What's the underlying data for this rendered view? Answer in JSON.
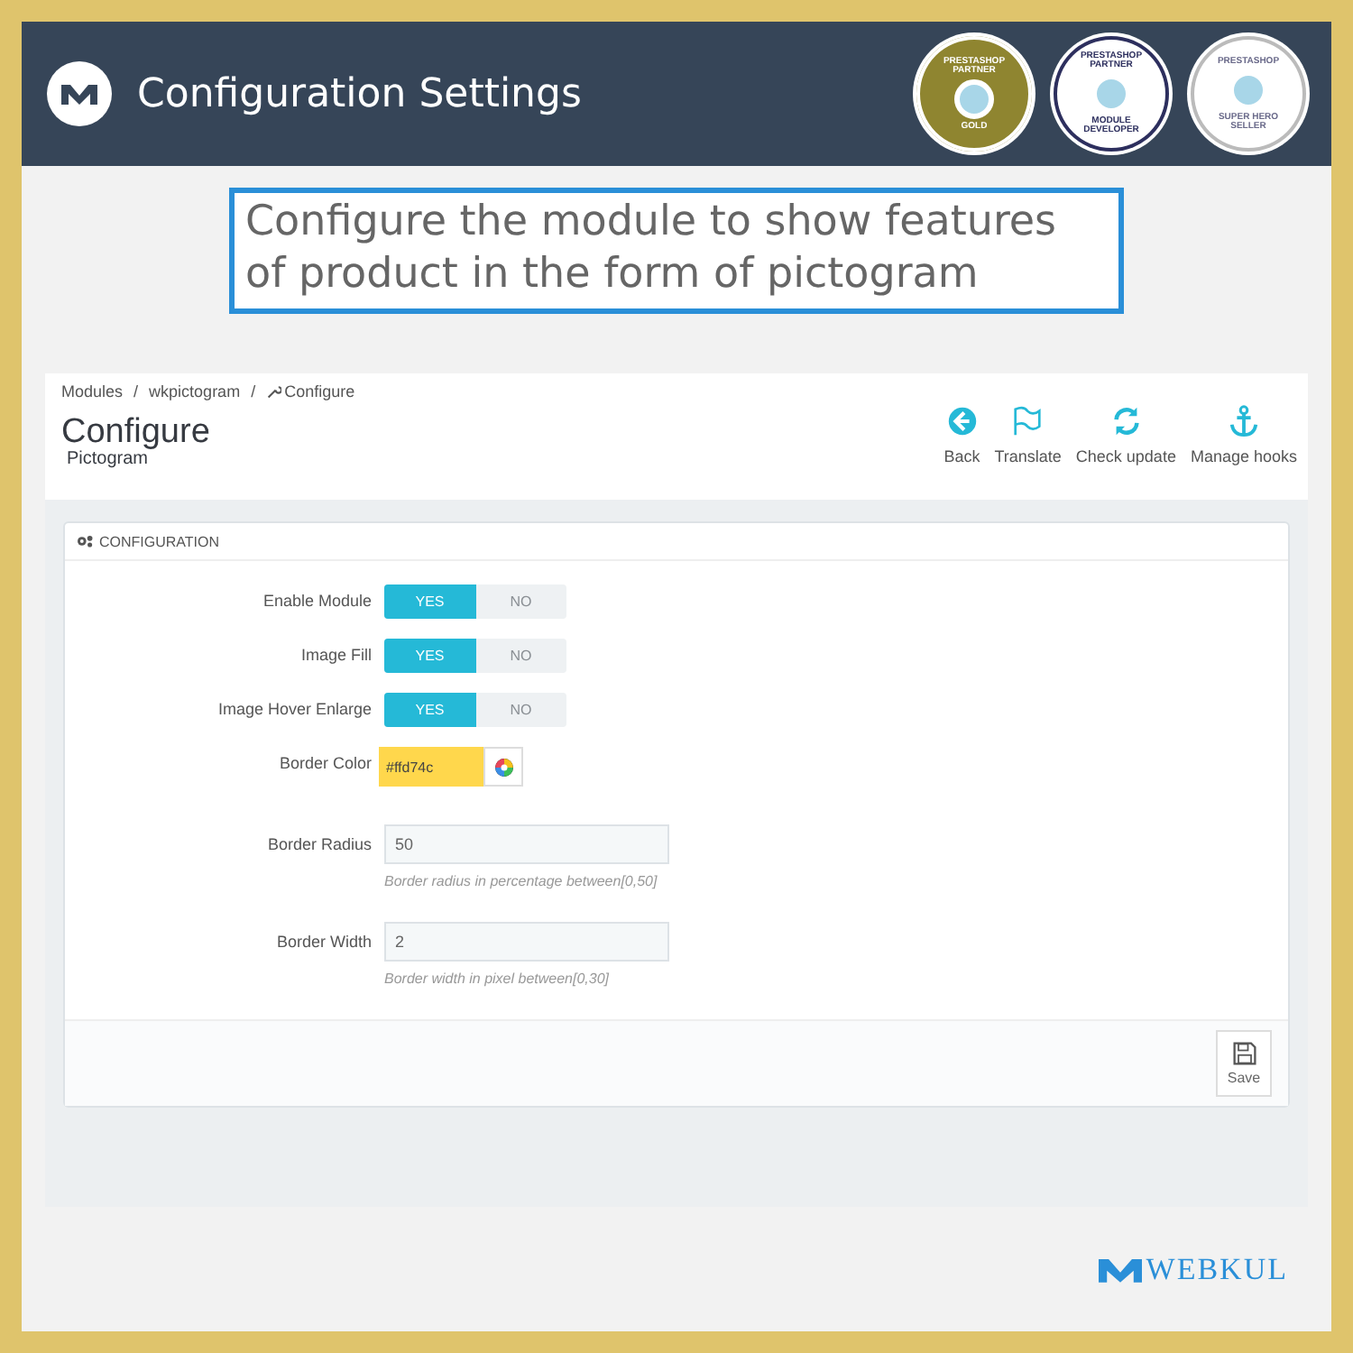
{
  "header": {
    "title": "Configuration Settings",
    "badges": [
      {
        "kind": "gold",
        "top": "PRESTASHOP PARTNER",
        "bottom": "GOLD"
      },
      {
        "kind": "developer",
        "top": "PRESTASHOP PARTNER",
        "bottom": "MODULE DEVELOPER"
      },
      {
        "kind": "hero",
        "top": "PRESTASHOP",
        "bottom": "SUPER HERO SELLER"
      }
    ]
  },
  "callout": [
    "Configure the module to show features",
    "of product in the form of pictogram"
  ],
  "breadcrumb": [
    "Modules",
    "wkpictogram",
    "Configure"
  ],
  "breadcrumb_separator": "/",
  "page_title": "Configure",
  "page_subtitle": "Pictogram",
  "toolbar": [
    {
      "label": "Back"
    },
    {
      "label": "Translate"
    },
    {
      "label": "Check update"
    },
    {
      "label": "Manage hooks"
    }
  ],
  "panel": {
    "heading": "CONFIGURATION",
    "fields": [
      {
        "kind": "switch",
        "label": "Enable Module",
        "on": true,
        "yes": "YES",
        "no": "NO"
      },
      {
        "kind": "switch",
        "label": "Image Fill",
        "on": true,
        "yes": "YES",
        "no": "NO"
      },
      {
        "kind": "switch",
        "label": "Image Hover Enlarge",
        "on": true,
        "yes": "YES",
        "no": "NO"
      },
      {
        "kind": "color",
        "label": "Border Color",
        "value": "#ffd74c"
      },
      {
        "kind": "text",
        "label": "Border Radius",
        "value": "50",
        "help": "Border radius in percentage between[0,50]"
      },
      {
        "kind": "text",
        "label": "Border Width",
        "value": "2",
        "help": "Border width in pixel between[0,30]"
      }
    ],
    "save": "Save"
  },
  "brand": "WEBKUL"
}
